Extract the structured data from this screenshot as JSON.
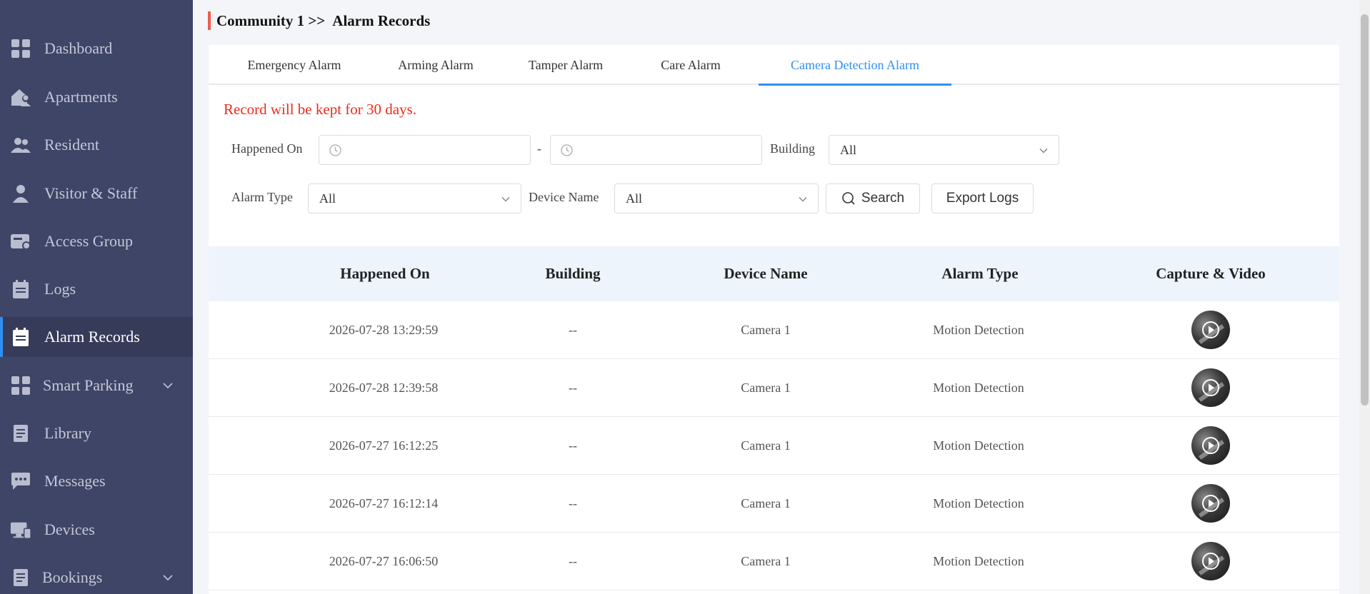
{
  "sidebar": {
    "items": [
      {
        "label": "Dashboard",
        "icon": "grid-icon"
      },
      {
        "label": "Apartments",
        "icon": "home-user-icon"
      },
      {
        "label": "Resident",
        "icon": "users-icon"
      },
      {
        "label": "Visitor & Staff",
        "icon": "user-icon"
      },
      {
        "label": "Access Group",
        "icon": "card-lock-icon"
      },
      {
        "label": "Logs",
        "icon": "calendar-icon"
      },
      {
        "label": "Alarm Records",
        "icon": "clipboard-icon",
        "active": true
      },
      {
        "label": "Smart Parking",
        "icon": "grid-icon",
        "expandable": true
      },
      {
        "label": "Library",
        "icon": "document-icon"
      },
      {
        "label": "Messages",
        "icon": "chat-icon"
      },
      {
        "label": "Devices",
        "icon": "monitor-icon"
      },
      {
        "label": "Bookings",
        "icon": "document-icon",
        "expandable": true
      }
    ]
  },
  "header": {
    "community": "Community 1 >>",
    "page": "Alarm Records"
  },
  "tabs": [
    {
      "label": "Emergency Alarm"
    },
    {
      "label": "Arming Alarm"
    },
    {
      "label": "Tamper Alarm"
    },
    {
      "label": "Care Alarm"
    },
    {
      "label": "Camera Detection Alarm",
      "active": true
    }
  ],
  "notice": "Record will be kept for 30 days.",
  "filters": {
    "happened_on_label": "Happened On",
    "range_separator": "-",
    "start_value": "",
    "end_value": "",
    "building_label": "Building",
    "building_value": "All",
    "alarm_type_label": "Alarm Type",
    "alarm_type_value": "All",
    "device_name_label": "Device Name",
    "device_name_value": "All",
    "search_label": "Search",
    "export_label": "Export Logs"
  },
  "table": {
    "headers": [
      "Happened On",
      "Building",
      "Device Name",
      "Alarm Type",
      "Capture & Video"
    ],
    "rows": [
      {
        "happened_on": "2026-07-28 13:29:59",
        "building": "--",
        "device": "Camera 1",
        "alarm_type": "Motion Detection"
      },
      {
        "happened_on": "2026-07-28 12:39:58",
        "building": "--",
        "device": "Camera 1",
        "alarm_type": "Motion Detection"
      },
      {
        "happened_on": "2026-07-27 16:12:25",
        "building": "--",
        "device": "Camera 1",
        "alarm_type": "Motion Detection"
      },
      {
        "happened_on": "2026-07-27 16:12:14",
        "building": "--",
        "device": "Camera 1",
        "alarm_type": "Motion Detection"
      },
      {
        "happened_on": "2026-07-27 16:06:50",
        "building": "--",
        "device": "Camera 1",
        "alarm_type": "Motion Detection"
      }
    ]
  },
  "colors": {
    "sidebar_bg": "#3f4566",
    "accent": "#2f8ff0",
    "notice": "#ee2b1b",
    "title_bar": "#f05a4a"
  }
}
